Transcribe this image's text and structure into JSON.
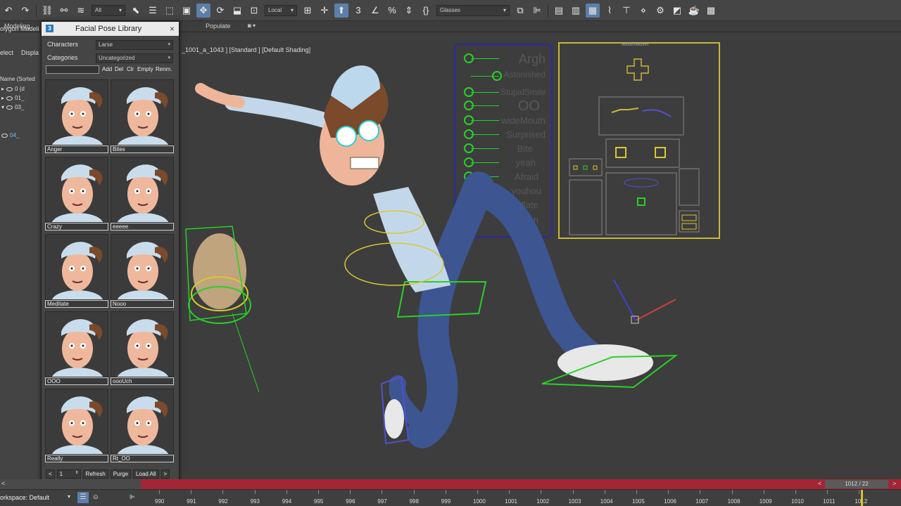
{
  "toolbar": {
    "filter_select": "All",
    "coord_select": "Local",
    "named_selection": "Glasses"
  },
  "ribbon": {
    "tab_modeling": "Modeling",
    "tab_polygon": "olygon Modeli",
    "populate": "Populate"
  },
  "scene": {
    "select": "elect",
    "display": "Displa",
    "name_header": "Name (Sorted",
    "rows": [
      "0 (d",
      "01_",
      "03_",
      "04_"
    ]
  },
  "viewport": {
    "label": "_1001_a_1043 ] [Standard ] [Default Shading]"
  },
  "facial_pose_library": {
    "title": "Facial Pose Library",
    "characters_label": "Characters",
    "characters_value": "Larse",
    "categories_label": "Categories",
    "categories_value": "Uncategorized",
    "buttons": {
      "add": "Add",
      "del": "Del",
      "clr": "Clr",
      "empty": "Empty",
      "renm": "Renm."
    },
    "poses": [
      "Anger",
      "Bites",
      "Crazy",
      "eeeee",
      "Meditate",
      "Nooo",
      "OOO",
      "oooUch",
      "Really",
      "Rt_OO"
    ],
    "page_value": "1",
    "refresh": "Refresh",
    "purge": "Purge",
    "load_all": "Load All"
  },
  "rig_panel": {
    "labels": [
      "Argh",
      "Astonished",
      "StupidSmile",
      "OO",
      "wideMouth",
      "Surprised",
      "Bite",
      "yeah",
      "Afraid",
      "youhou",
      "Inflate",
      "Ouch"
    ],
    "mouth_title": "MouthMover"
  },
  "timeline": {
    "frame_readout": "1012 / 22",
    "workspace": "orkspace: Default",
    "ticks": [
      "990",
      "991",
      "992",
      "993",
      "994",
      "995",
      "996",
      "997",
      "998",
      "999",
      "1000",
      "1001",
      "1002",
      "1003",
      "1004",
      "1005",
      "1006",
      "1007",
      "1008",
      "1009",
      "1010",
      "1011",
      "1012"
    ]
  },
  "colors": {
    "rig_green": "#28d028",
    "rig_blue": "#2a2aa0",
    "rig_yellow": "#c8b838",
    "timeslider_red": "#a52436",
    "active_tool": "#5b7fa8"
  }
}
